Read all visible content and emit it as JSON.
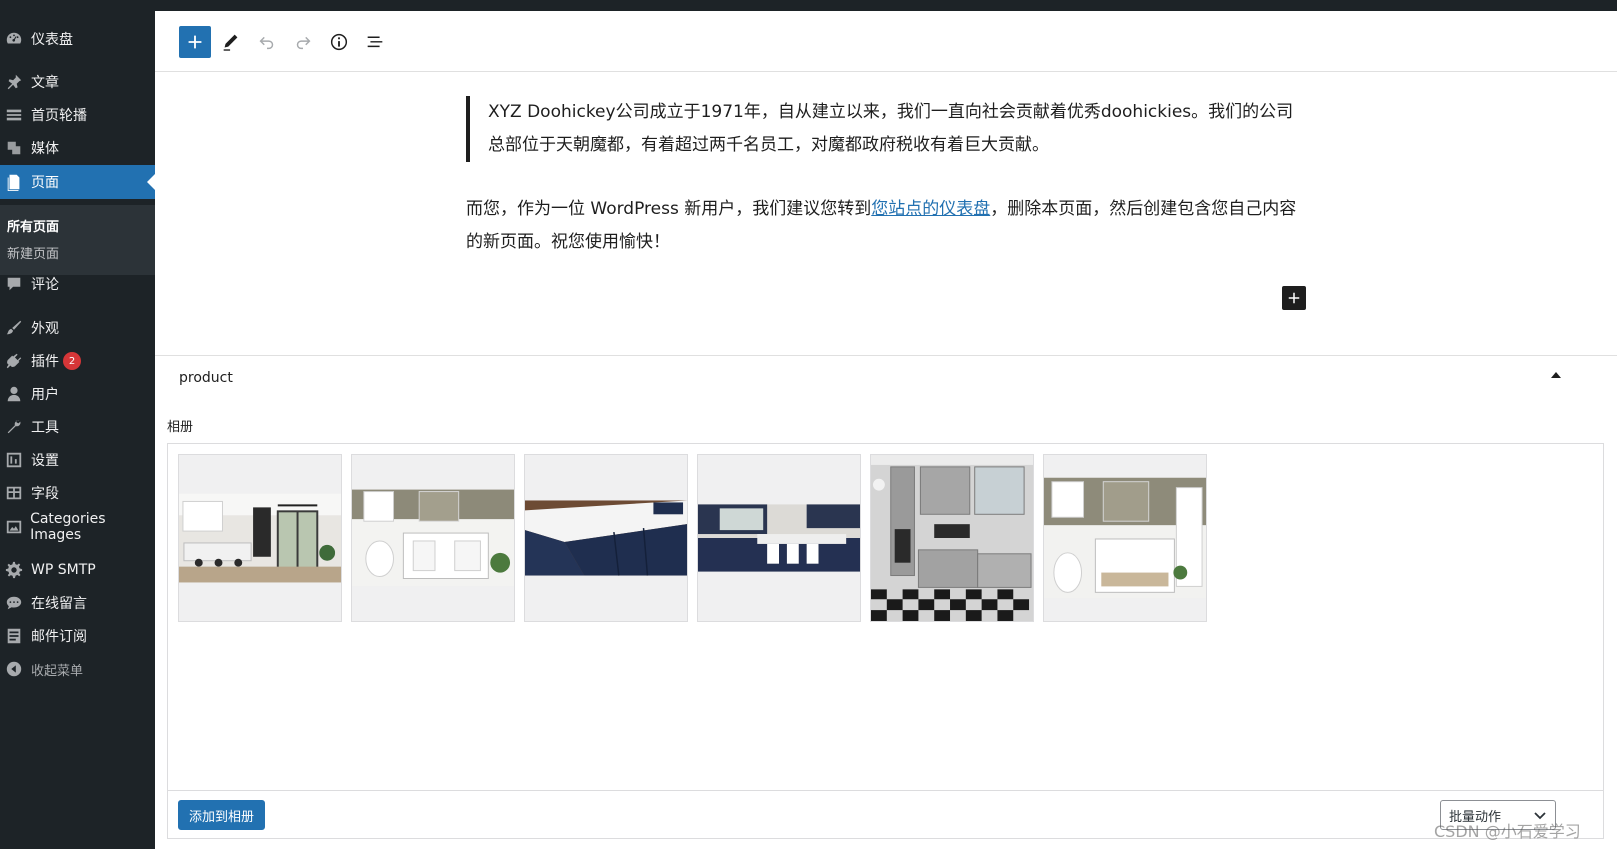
{
  "sidebar": {
    "items": [
      {
        "label": "仪表盘",
        "icon": "dashboard-icon"
      },
      {
        "label": "文章",
        "icon": "pin-icon"
      },
      {
        "label": "首页轮播",
        "icon": "slides-icon"
      },
      {
        "label": "媒体",
        "icon": "media-icon"
      },
      {
        "label": "页面",
        "icon": "page-icon"
      },
      {
        "label": "评论",
        "icon": "comment-icon"
      },
      {
        "label": "外观",
        "icon": "brush-icon"
      },
      {
        "label": "插件",
        "icon": "plugin-icon",
        "badge": "2"
      },
      {
        "label": "用户",
        "icon": "user-icon"
      },
      {
        "label": "工具",
        "icon": "wrench-icon"
      },
      {
        "label": "设置",
        "icon": "settings-icon"
      },
      {
        "label": "字段",
        "icon": "fields-icon"
      },
      {
        "label": "Categories Images",
        "icon": "image-icon"
      },
      {
        "label": "WP SMTP",
        "icon": "gear-icon"
      },
      {
        "label": "在线留言",
        "icon": "chat-icon"
      },
      {
        "label": "邮件订阅",
        "icon": "list-icon"
      },
      {
        "label": "收起菜单",
        "icon": "collapse-icon"
      }
    ],
    "submenu": [
      "所有页面",
      "新建页面"
    ]
  },
  "toolbar": {
    "buttons": [
      "add-block",
      "edit",
      "undo",
      "redo",
      "info",
      "outline"
    ]
  },
  "content": {
    "quote": "XYZ Doohickey公司成立于1971年，自从建立以来，我们一直向社会贡献着优秀doohickies。我们的公司总部位于天朝魔都，有着超过两千名员工，对魔都政府税收有着巨大贡献。",
    "para_before": "而您，作为一位 WordPress 新用户，我们建议您转到",
    "para_link": "您站点的仪表盘",
    "para_after": "，删除本页面，然后创建包含您自己内容的新页面。祝您使用愉快！"
  },
  "metabox": {
    "title": "product",
    "album_label": "相册",
    "add_button": "添加到相册",
    "bulk_label": "批量动作",
    "thumbnails": [
      "kitchen-white",
      "bathroom-vanity",
      "navy-island",
      "navy-kitchen",
      "gray-kitchen-checker",
      "bathroom-vanity-2"
    ]
  },
  "watermark": "CSDN @小石爱学习",
  "colors": {
    "accent": "#2271b1",
    "sidebar": "#1d2327",
    "submenu": "#2c3338"
  }
}
